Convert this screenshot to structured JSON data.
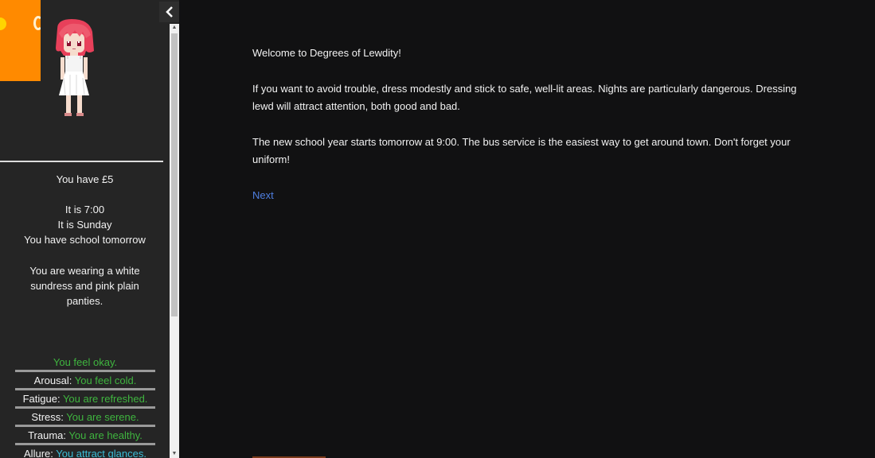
{
  "sidebar": {
    "money": "You have £5",
    "time": "It is 7:00",
    "day": "It is Sunday",
    "school": "You have school tomorrow",
    "clothing": "You are wearing a white sundress and pink plain panties.",
    "status": [
      {
        "label": "",
        "value": "You feel okay.",
        "tone": "good"
      },
      {
        "label": "Arousal: ",
        "value": "You feel cold.",
        "tone": "good"
      },
      {
        "label": "Fatigue: ",
        "value": "You are refreshed.",
        "tone": "good"
      },
      {
        "label": "Stress: ",
        "value": "You are serene.",
        "tone": "good"
      },
      {
        "label": "Trauma: ",
        "value": "You are healthy.",
        "tone": "good"
      },
      {
        "label": "Allure: ",
        "value": "You attract glances.",
        "tone": "blue"
      }
    ]
  },
  "main": {
    "paragraphs": [
      "Welcome to Degrees of Lewdity!",
      "If you want to avoid trouble, dress modestly and stick to safe, well-lit areas. Nights are particularly dangerous. Dressing lewd will attract attention, both good and bad.",
      "The new school year starts tomorrow at 9:00. The bus service is the easiest way to get around town. Don't forget your uniform!"
    ],
    "next_link": "Next"
  },
  "icons": {
    "collapse": "chevron-left-icon",
    "clock": "day-night-clock-icon",
    "avatar": "character-avatar"
  },
  "colors": {
    "background": "#111112",
    "sidebar": "#252525",
    "good_status": "#3fb53f",
    "allure_status": "#3bbcd6",
    "link": "#4f7fe0",
    "clock_day": "#ff8a00"
  }
}
